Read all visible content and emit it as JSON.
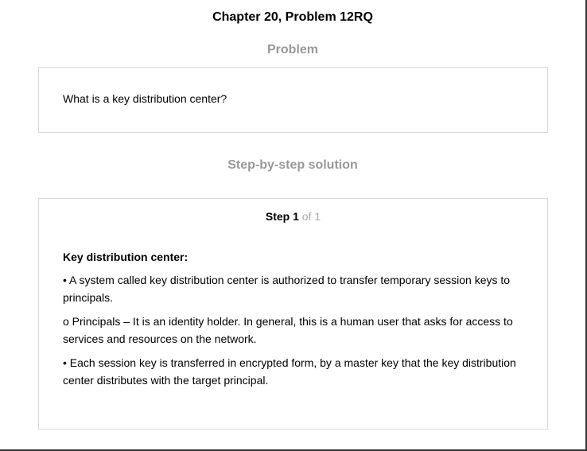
{
  "page_title": "Chapter 20, Problem 12RQ",
  "problem": {
    "heading": "Problem",
    "text": "What is a key distribution center?"
  },
  "solution": {
    "heading": "Step-by-step solution",
    "step": {
      "label": "Step 1",
      "of_text": "of 1"
    },
    "content": {
      "heading": "Key distribution center:",
      "paragraphs": [
        "• A system called key distribution center is authorized to transfer temporary session keys to principals.",
        "o Principals – It is an identity holder. In general, this is a human user that asks for access to services and resources on the network.",
        "• Each session key is transferred in encrypted form, by a master key that the key distribution center distributes with the target principal."
      ]
    }
  }
}
